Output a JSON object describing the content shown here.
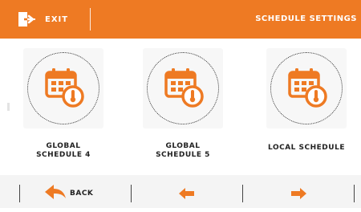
{
  "header": {
    "exit_label": "EXIT",
    "title": "SCHEDULE SETTINGS",
    "exit_icon": "exit-door-icon"
  },
  "tiles": [
    {
      "line1": "GLOBAL",
      "line2": "SCHEDULE 4",
      "icon": "calendar-thermometer-icon"
    },
    {
      "line1": "GLOBAL",
      "line2": "SCHEDULE 5",
      "icon": "calendar-thermometer-icon"
    },
    {
      "line1": "LOCAL SCHEDULE",
      "line2": "",
      "icon": "calendar-thermometer-icon"
    }
  ],
  "footer": {
    "back_label": "BACK",
    "back_icon": "back-arrow-icon",
    "prev_icon": "arrow-left-icon",
    "next_icon": "arrow-right-icon"
  },
  "colors": {
    "accent": "#ee7a23",
    "background": "#ffffff",
    "bottom_bar": "#f4f4f4"
  }
}
